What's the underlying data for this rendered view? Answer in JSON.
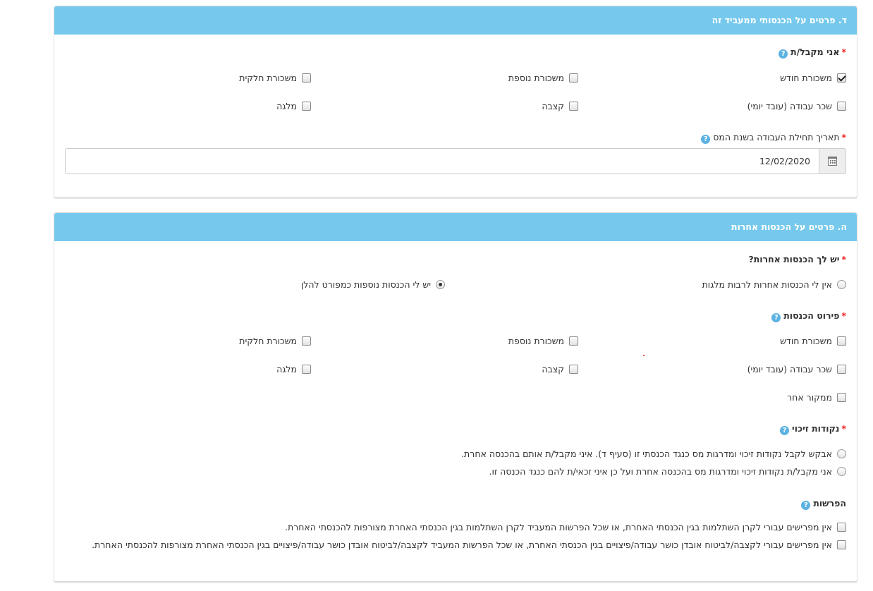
{
  "section_d": {
    "header": "ד. פרטים על הכנסותי ממעביד זה",
    "receive_question": "אני מקבל/ת",
    "receive_options": [
      {
        "label": "משכורת חודש",
        "checked": true
      },
      {
        "label": "משכורת נוספת",
        "checked": false
      },
      {
        "label": "משכורת חלקית",
        "checked": false
      },
      {
        "label": "שכר עבודה (עובד יומי)",
        "checked": false
      },
      {
        "label": "קצבה",
        "checked": false
      },
      {
        "label": "מלגה",
        "checked": false
      }
    ],
    "start_date_label": "תאריך תחילת העבודה בשנת המס",
    "start_date_value": "12/02/2020"
  },
  "section_e": {
    "header": "ה. פרטים על הכנסות אחרות",
    "other_income_question": "יש לך הכנסות אחרות?",
    "other_income_options": [
      {
        "label": "אין לי הכנסות אחרות לרבות מלגות",
        "checked": false
      },
      {
        "label": "יש לי הכנסות נוספות כמפורט להלן",
        "checked": true
      }
    ],
    "income_details_label": "פירוט הכנסות",
    "income_details_options": [
      {
        "label": "משכורת חודש",
        "checked": false
      },
      {
        "label": "משכורת נוספת",
        "checked": false
      },
      {
        "label": "משכורת חלקית",
        "checked": false
      },
      {
        "label": "שכר עבודה (עובד יומי)",
        "checked": false
      },
      {
        "label": "קצבה",
        "checked": false
      },
      {
        "label": "מלגה",
        "checked": false
      },
      {
        "label": "ממקור אחר",
        "checked": false
      }
    ],
    "credit_points_label": "נקודות זיכוי",
    "credit_points_options": [
      {
        "label": "אבקש לקבל נקודות זיכוי ומדרגות מס כנגד הכנסתי זו (סעיף ד). איני מקבל/ת אותם בהכנסה אחרת.",
        "checked": false
      },
      {
        "label": "אני מקבל/ת נקודות זיכוי ומדרגות מס בהכנסה אחרת ועל כן איני זכאי/ת להם כנגד הכנסה זו.",
        "checked": false
      }
    ],
    "deductions_label": "הפרשות",
    "deductions_options": [
      {
        "label": "אין מפרישים עבורי לקרן השתלמות בגין הכנסתי האחרת, או שכל הפרשות המעביד לקרן השתלמות בגין הכנסתי האחרת מצורפות להכנסתי האחרת.",
        "checked": false
      },
      {
        "label": "אין מפרישים עבורי לקצבה/לביטוח אובדן כושר עבודה/פיצויים בגין הכנסתי האחרת, או שכל הפרשות המעביד לקצבה/לביטוח אובדן כושר עבודה/פיצויים בגין הכנסתי האחרת מצורפות להכנסתי האחרת.",
        "checked": false
      }
    ]
  },
  "icons": {
    "help": "question-circle-icon",
    "calendar": "calendar-icon"
  },
  "colors": {
    "panel_header": "#76c9ec",
    "required": "#ee2222",
    "help_icon": "#5bb2e3"
  }
}
